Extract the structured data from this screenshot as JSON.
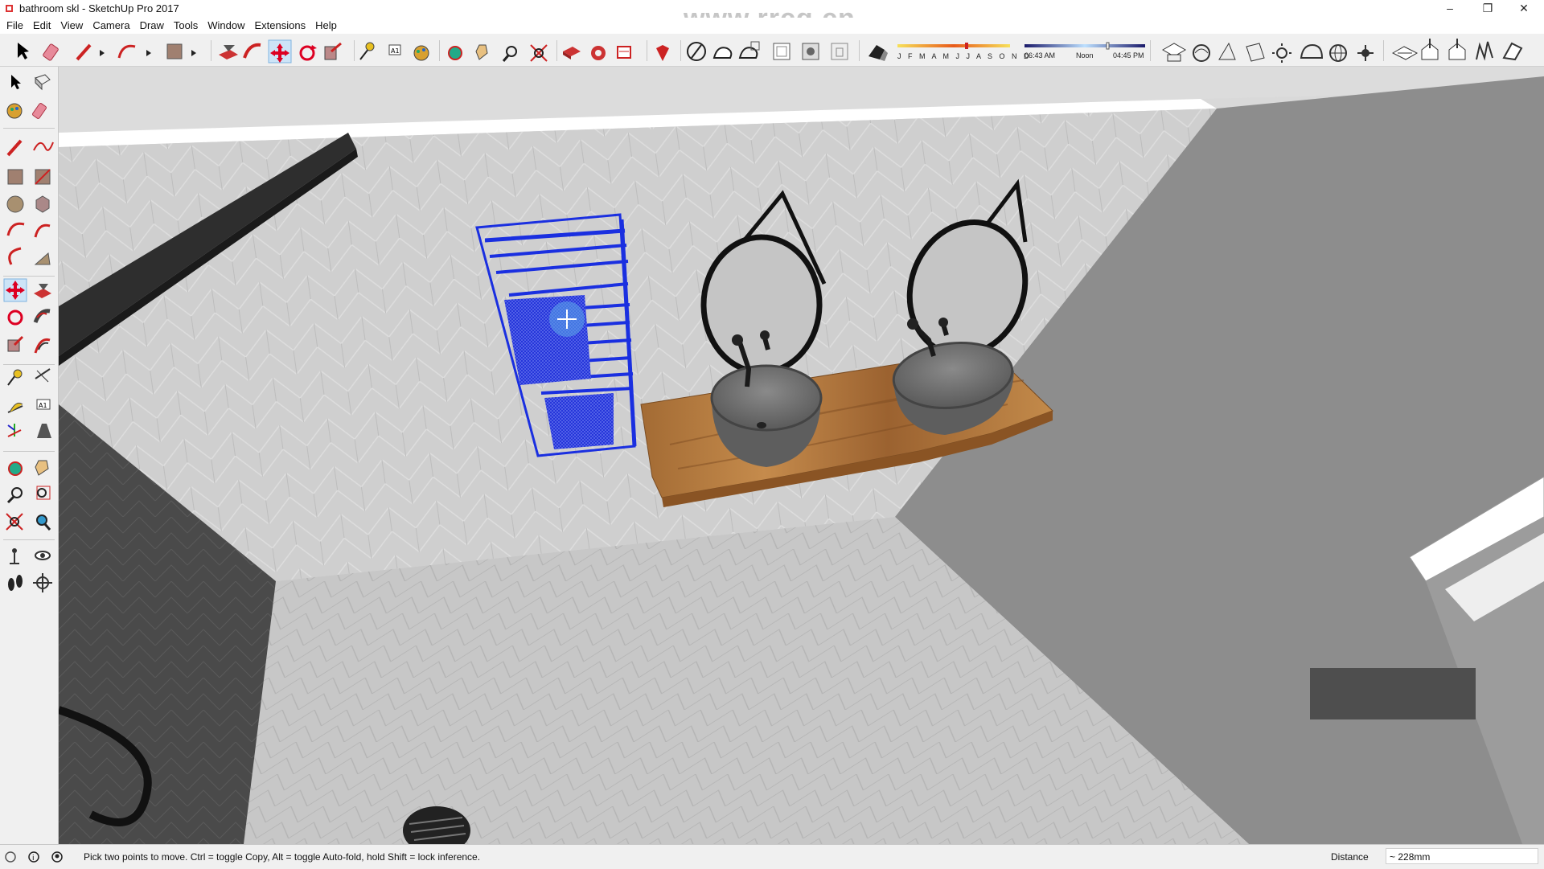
{
  "window": {
    "title": "bathroom skl - SketchUp Pro 2017",
    "watermark_url": "www.rrcg.cn",
    "controls": {
      "minimize": "–",
      "maximize": "❐",
      "close": "✕"
    }
  },
  "menu": [
    "File",
    "Edit",
    "View",
    "Camera",
    "Draw",
    "Tools",
    "Window",
    "Extensions",
    "Help"
  ],
  "toolbar": {
    "icons": [
      "select-icon",
      "eraser-icon",
      "pencil-icon",
      "arc-icon",
      "rectangle-icon",
      "push-pull-icon",
      "follow-me-icon",
      "move-icon",
      "rotate-icon",
      "scale-icon",
      "tape-measure-icon",
      "text-icon",
      "paint-bucket-icon",
      "orbit-icon",
      "pan-icon",
      "zoom-icon",
      "zoom-extents-icon",
      "warehouse-icon",
      "extension-warehouse-icon",
      "layout-icon",
      "ruby-icon"
    ],
    "active": "move-icon",
    "shadow": {
      "months": "J F M A M J J A S O N D",
      "time_start": "06:43 AM",
      "time_mid": "Noon",
      "time_end": "04:45 PM"
    }
  },
  "palette": {
    "active": "move-tool",
    "tools": [
      "select",
      "component",
      "paint",
      "eraser",
      "line",
      "freehand",
      "rectangle",
      "rotated-rectangle",
      "circle",
      "polygon",
      "arc",
      "2pt-arc",
      "3pt-arc",
      "pie",
      "move",
      "push-pull",
      "rotate",
      "follow-me",
      "scale",
      "offset",
      "tape-measure",
      "dimension",
      "protractor",
      "text",
      "axes",
      "3d-text",
      "orbit",
      "pan",
      "zoom",
      "zoom-window",
      "zoom-extents",
      "previous",
      "position-camera",
      "look-around",
      "walk",
      "section-plane"
    ]
  },
  "status": {
    "hint": "Pick two points to move.  Ctrl = toggle Copy, Alt = toggle Auto-fold, hold Shift = lock inference.",
    "vcb_label": "Distance",
    "vcb_value": "~ 228mm"
  },
  "colors": {
    "selection": "#1a2fe0",
    "wood": "#b57a3e",
    "sink": "#6e6e6e",
    "tile": "#cfcfcf"
  }
}
